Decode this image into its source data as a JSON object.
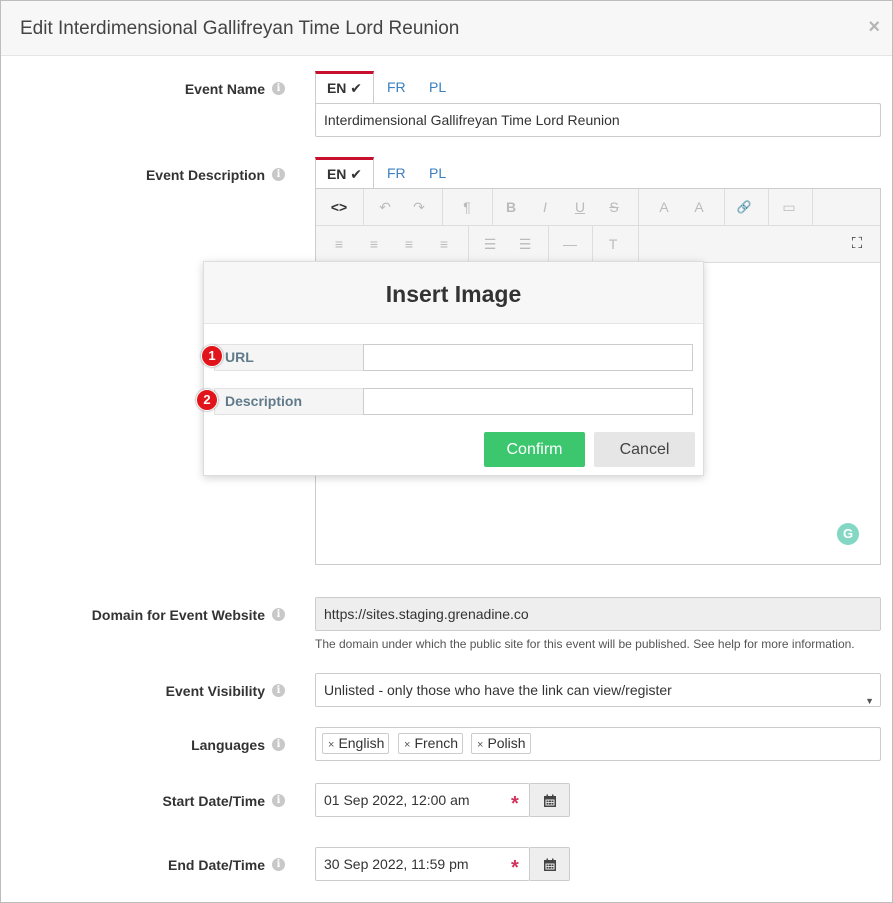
{
  "modal": {
    "title": "Edit Interdimensional Gallifreyan Time Lord Reunion",
    "close": "×"
  },
  "langs": [
    "EN",
    "FR",
    "PL"
  ],
  "check_glyph": "✔",
  "info_glyph": "i",
  "fields": {
    "event_name": {
      "label": "Event Name",
      "value": "Interdimensional Gallifreyan Time Lord Reunion"
    },
    "event_description": {
      "label": "Event Description"
    },
    "domain": {
      "label": "Domain for Event Website",
      "value": "https://sites.staging.grenadine.co",
      "help": "The domain under which the public site for this event will be published. See help for more information."
    },
    "visibility": {
      "label": "Event Visibility",
      "value": "Unlisted - only those who have the link can view/register"
    },
    "languages": {
      "label": "Languages",
      "tags": [
        "English",
        "French",
        "Polish"
      ]
    },
    "start": {
      "label": "Start Date/Time",
      "value": "01 Sep 2022, 12:00 am"
    },
    "end": {
      "label": "End Date/Time",
      "value": "30 Sep 2022, 11:59 pm"
    }
  },
  "editor": {
    "toolbar1": [
      "<>",
      "↶",
      "↷",
      "¶",
      "B",
      "I",
      "U",
      "S",
      "A",
      "A",
      "🔗",
      "▭"
    ],
    "toolbar2": [
      "≡",
      "≡",
      "≡",
      "≡",
      "☰",
      "☰",
      "—",
      "T",
      "⛶"
    ],
    "grammarly": "G"
  },
  "insert_image": {
    "title": "Insert Image",
    "url_label": "URL",
    "description_label": "Description",
    "confirm": "Confirm",
    "cancel": "Cancel",
    "badges": [
      "1",
      "2"
    ]
  },
  "required_mark": "*",
  "tag_remove": "×",
  "caret": "▼"
}
